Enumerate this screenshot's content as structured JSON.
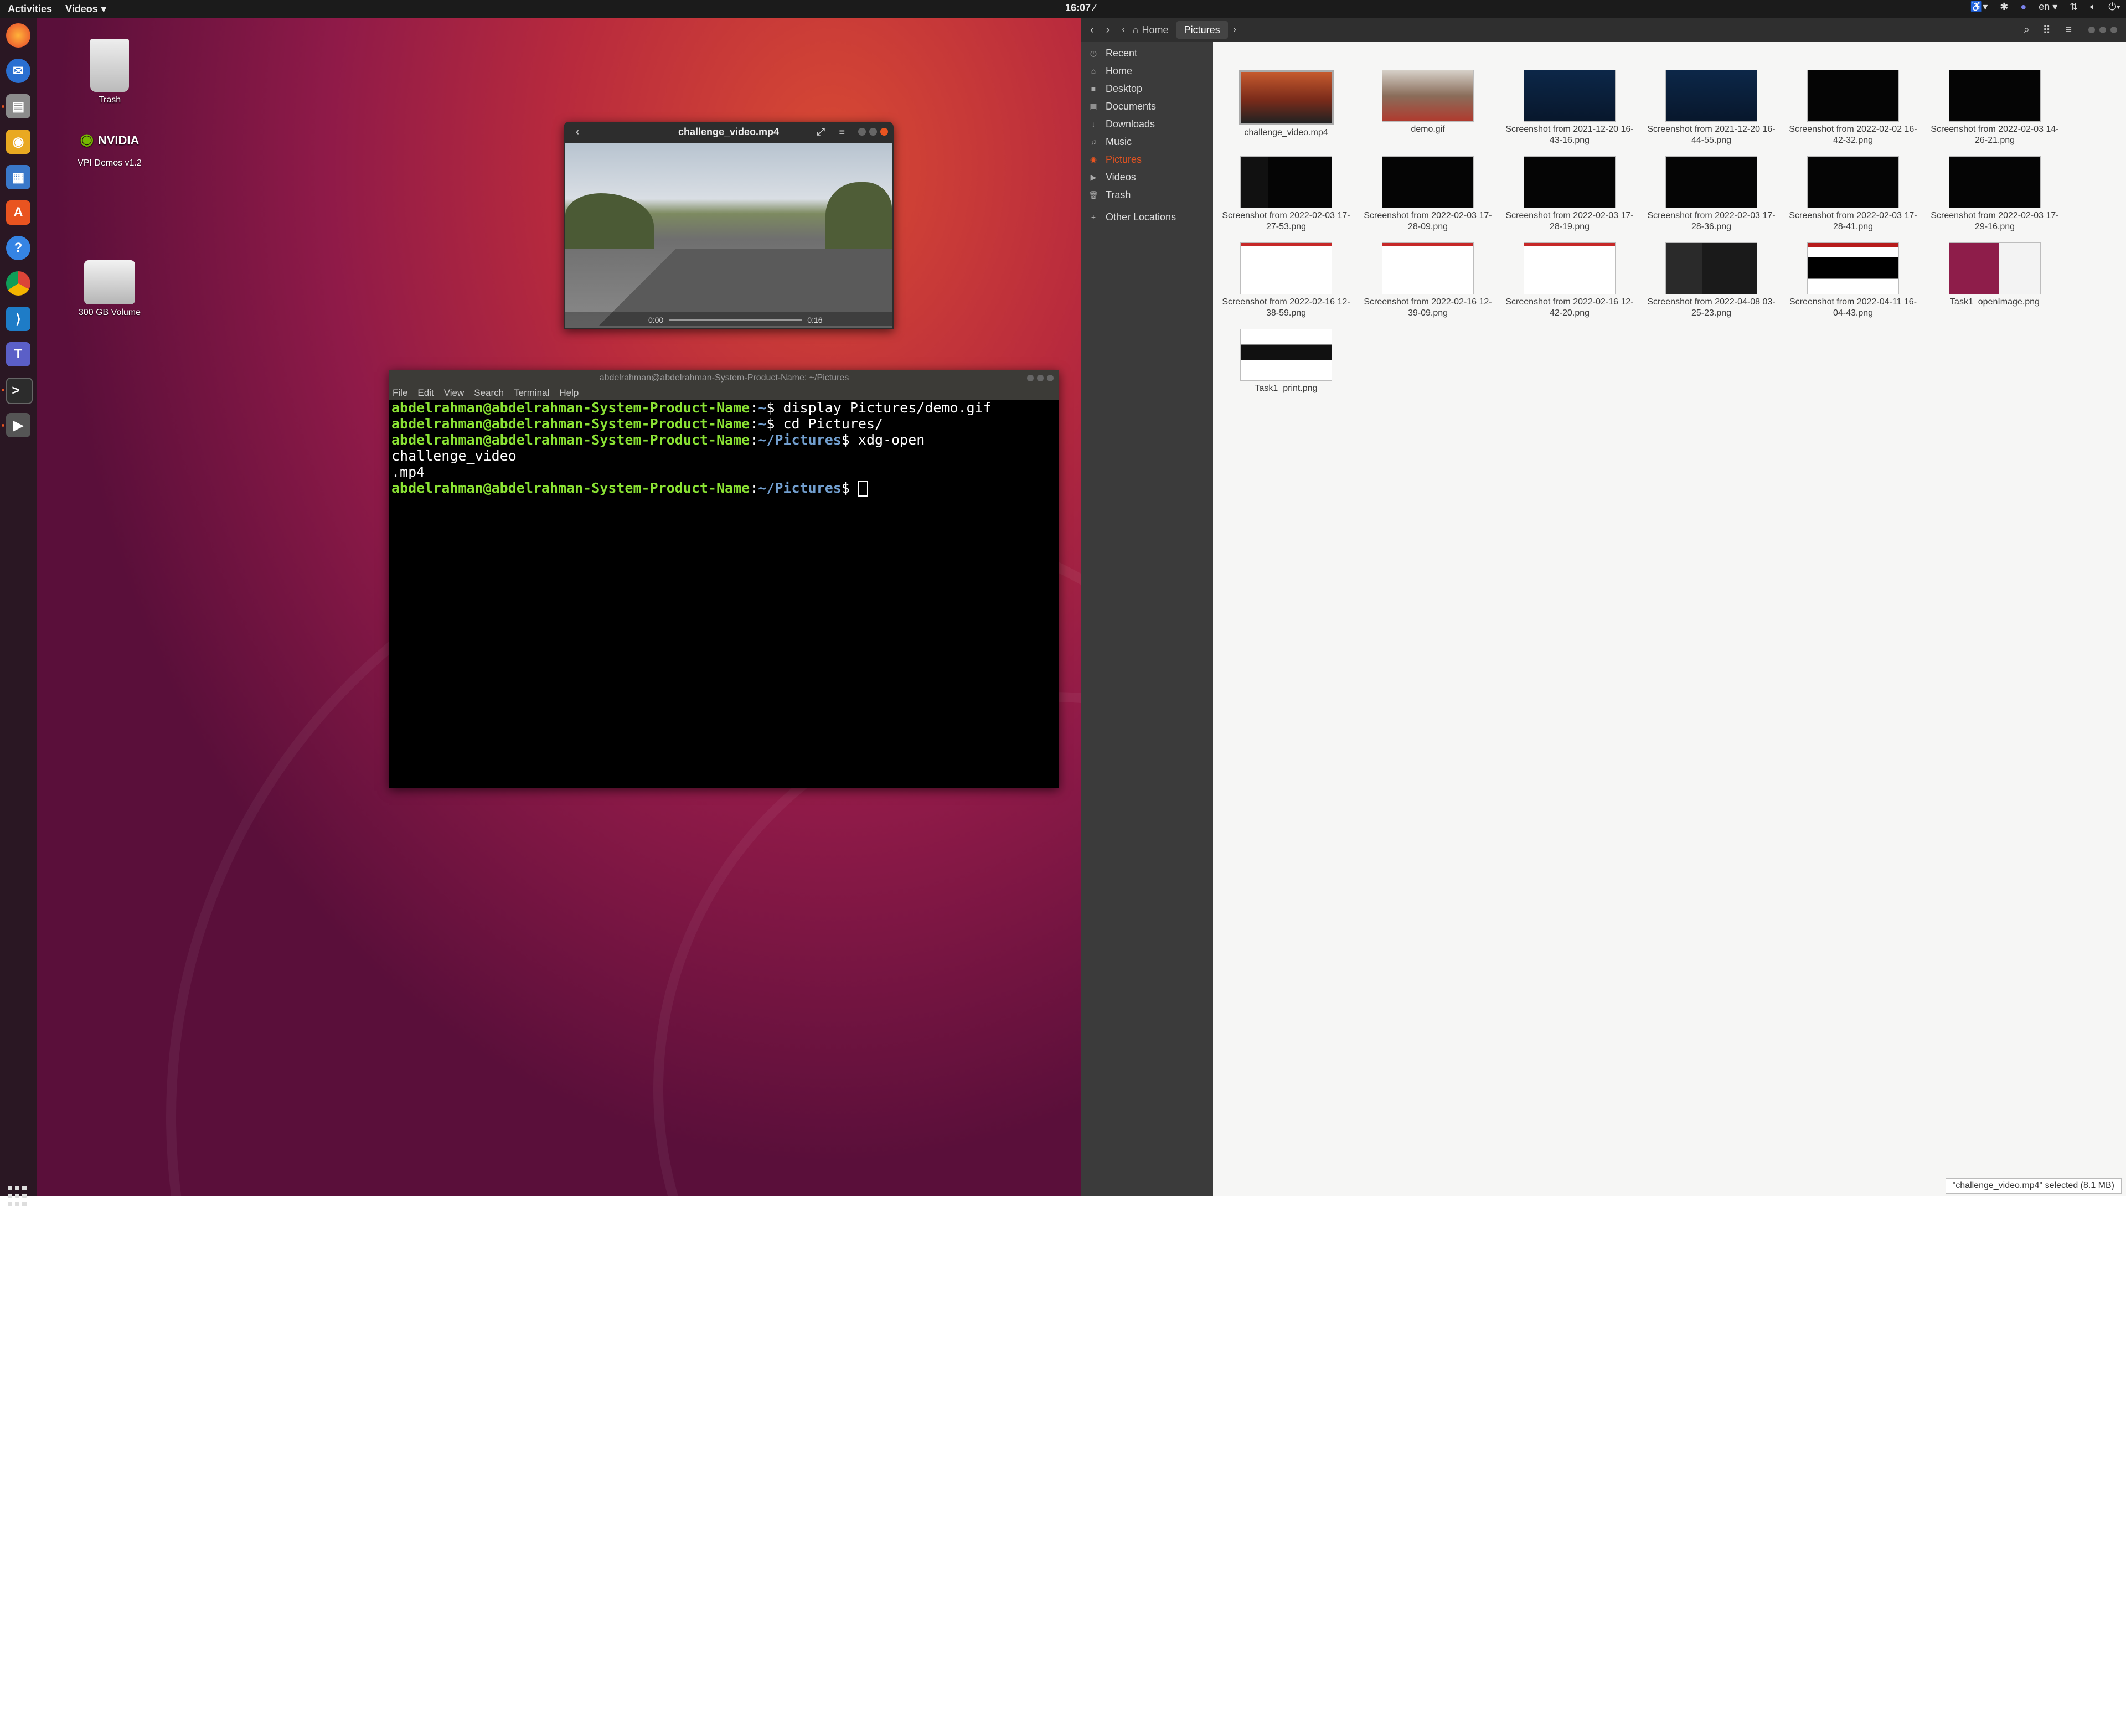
{
  "topbar": {
    "activities": "Activities",
    "app_menu": "Videos",
    "clock": "16:07 ⁄",
    "language": "en"
  },
  "dock": {
    "apps": [
      "Firefox",
      "Thunderbird",
      "Files",
      "Rhythmbox",
      "LibreOffice Writer",
      "Ubuntu Software",
      "Help",
      "Chrome",
      "VS Code",
      "Teams",
      "Terminal",
      "Videos"
    ]
  },
  "desktop": {
    "icons": [
      {
        "label": "Trash"
      },
      {
        "label": "VPI Demos v1.2"
      },
      {
        "label": "300 GB Volume"
      }
    ]
  },
  "video_window": {
    "title": "challenge_video.mp4",
    "time_elapsed": "0:00",
    "time_total": "0:16"
  },
  "terminal": {
    "title": "abdelrahman@abdelrahman-System-Product-Name: ~/Pictures",
    "menu": [
      "File",
      "Edit",
      "View",
      "Search",
      "Terminal",
      "Help"
    ],
    "prompt_user": "abdelrahman@abdelrahman-System-Product-Name",
    "lines": [
      {
        "dir": "~",
        "cmd": " display Pictures/demo.gif"
      },
      {
        "dir": "~",
        "cmd": " cd Pictures/"
      },
      {
        "dir": "~/Pictures",
        "cmd": " xdg-open challenge_video"
      },
      {
        "continuation": ".mp4"
      },
      {
        "dir": "~/Pictures",
        "cmd": " "
      }
    ]
  },
  "file_manager": {
    "path": [
      "Home",
      "Pictures"
    ],
    "sidebar": [
      "Recent",
      "Home",
      "Desktop",
      "Documents",
      "Downloads",
      "Music",
      "Pictures",
      "Videos",
      "Trash",
      "Other Locations"
    ],
    "files": [
      {
        "name": "challenge_video.mp4",
        "thumb": "video"
      },
      {
        "name": "demo.gif",
        "thumb": "gif"
      },
      {
        "name": "Screenshot from 2021-12-20 16-43-16.png",
        "thumb": "blue"
      },
      {
        "name": "Screenshot from 2021-12-20 16-44-55.png",
        "thumb": "blue"
      },
      {
        "name": "Screenshot from 2022-02-02 16-42-32.png",
        "thumb": "dark"
      },
      {
        "name": "Screenshot from 2022-02-03 14-26-21.png",
        "thumb": "dark"
      },
      {
        "name": "Screenshot from 2022-02-03 17-27-53.png",
        "thumb": "dark2"
      },
      {
        "name": "Screenshot from 2022-02-03 17-28-09.png",
        "thumb": "dark"
      },
      {
        "name": "Screenshot from 2022-02-03 17-28-19.png",
        "thumb": "dark"
      },
      {
        "name": "Screenshot from 2022-02-03 17-28-36.png",
        "thumb": "dark"
      },
      {
        "name": "Screenshot from 2022-02-03 17-28-41.png",
        "thumb": "dark"
      },
      {
        "name": "Screenshot from 2022-02-03 17-29-16.png",
        "thumb": "dark"
      },
      {
        "name": "Screenshot from 2022-02-16 12-38-59.png",
        "thumb": "white"
      },
      {
        "name": "Screenshot from 2022-02-16 12-39-09.png",
        "thumb": "white"
      },
      {
        "name": "Screenshot from 2022-02-16 12-42-20.png",
        "thumb": "white"
      },
      {
        "name": "Screenshot from 2022-04-08 03-25-23.png",
        "thumb": "gray"
      },
      {
        "name": "Screenshot from 2022-04-11 16-04-43.png",
        "thumb": "mixed"
      },
      {
        "name": "Task1_openImage.png",
        "thumb": "desk"
      },
      {
        "name": "Task1_print.png",
        "thumb": "print"
      }
    ],
    "status": "\"challenge_video.mp4\" selected (8.1 MB)"
  }
}
